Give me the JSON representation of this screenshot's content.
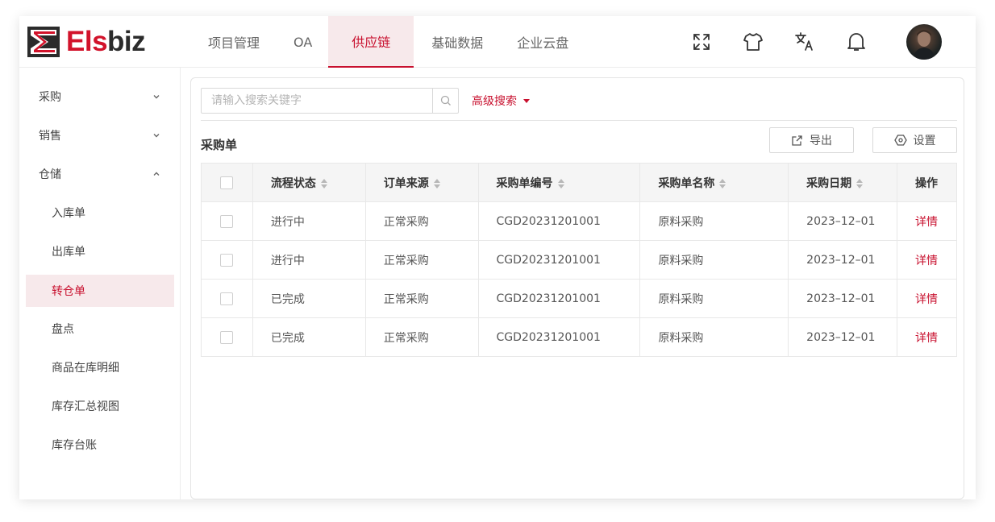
{
  "brand": {
    "logo_text_1": "Els",
    "logo_text_2": "biz",
    "accent_color": "#c8102e"
  },
  "nav": {
    "items": [
      {
        "label": "项目管理"
      },
      {
        "label": "OA"
      },
      {
        "label": "供应链",
        "active": true
      },
      {
        "label": "基础数据"
      },
      {
        "label": "企业云盘"
      }
    ]
  },
  "header_icons": [
    "fullscreen-icon",
    "theme-shirt-icon",
    "translate-icon",
    "bell-icon"
  ],
  "sidebar": {
    "items": [
      {
        "label": "采购",
        "level": 1,
        "expanded": false
      },
      {
        "label": "销售",
        "level": 1,
        "expanded": false
      },
      {
        "label": "仓储",
        "level": 1,
        "expanded": true
      },
      {
        "label": "入库单",
        "level": 2
      },
      {
        "label": "出库单",
        "level": 2
      },
      {
        "label": "转仓单",
        "level": 2,
        "active": true
      },
      {
        "label": "盘点",
        "level": 2
      },
      {
        "label": "商品在库明细",
        "level": 2
      },
      {
        "label": "库存汇总视图",
        "level": 2
      },
      {
        "label": "库存台账",
        "level": 2
      }
    ]
  },
  "search": {
    "placeholder": "请输入搜索关键字",
    "value": "",
    "advanced_label": "高级搜索"
  },
  "page": {
    "title": "采购单",
    "export_label": "导出",
    "settings_label": "设置"
  },
  "table": {
    "columns": [
      "流程状态",
      "订单来源",
      "采购单编号",
      "采购单名称",
      "采购日期",
      "操作"
    ],
    "rows": [
      {
        "status": "进行中",
        "status_type": "progress",
        "source": "正常采购",
        "code": "CGD20231201001",
        "name": "原料采购",
        "date": "2023–12–01",
        "action": "详情"
      },
      {
        "status": "进行中",
        "status_type": "progress",
        "source": "正常采购",
        "code": "CGD20231201001",
        "name": "原料采购",
        "date": "2023–12–01",
        "action": "详情"
      },
      {
        "status": "已完成",
        "status_type": "done",
        "source": "正常采购",
        "code": "CGD20231201001",
        "name": "原料采购",
        "date": "2023–12–01",
        "action": "详情"
      },
      {
        "status": "已完成",
        "status_type": "done",
        "source": "正常采购",
        "code": "CGD20231201001",
        "name": "原料采购",
        "date": "2023–12–01",
        "action": "详情"
      }
    ]
  },
  "colors": {
    "status_progress": "#e0780d",
    "status_done": "#23903b",
    "active_bg": "#f7e9eb"
  }
}
